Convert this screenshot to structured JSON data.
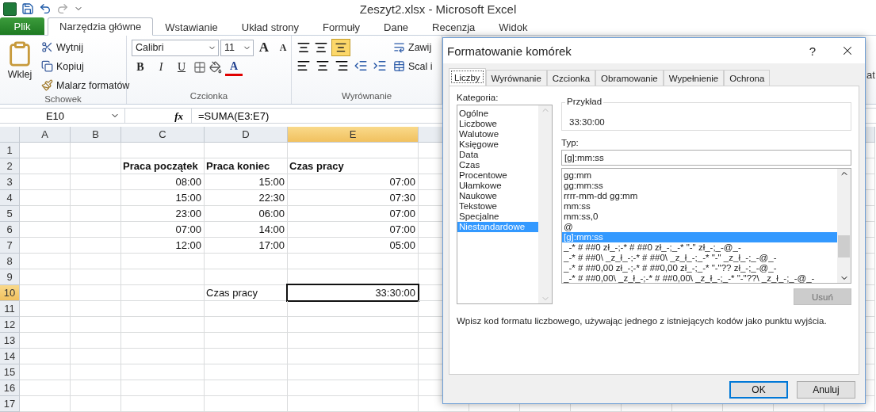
{
  "window": {
    "title": "Zeszyt2.xlsx - Microsoft Excel"
  },
  "ribbon": {
    "file_tab": "Plik",
    "tabs": [
      {
        "label": "Narzędzia główne",
        "selected": true
      },
      {
        "label": "Wstawianie",
        "selected": false
      },
      {
        "label": "Układ strony",
        "selected": false
      },
      {
        "label": "Formuły",
        "selected": false
      },
      {
        "label": "Dane",
        "selected": false
      },
      {
        "label": "Recenzja",
        "selected": false
      },
      {
        "label": "Widok",
        "selected": false
      }
    ],
    "clipboard": {
      "paste": "Wklej",
      "cut": "Wytnij",
      "copy": "Kopiuj",
      "painter": "Malarz formatów",
      "group": "Schowek"
    },
    "font": {
      "name": "Calibri",
      "size": "11",
      "grow": "A",
      "shrink": "A",
      "bold": "B",
      "italic": "I",
      "underline": "U",
      "font_color_letter": "A",
      "group": "Czcionka"
    },
    "alignment": {
      "wrap": "Zawij",
      "merge": "Scal i",
      "group": "Wyrównanie",
      "bottom_align_on": true
    },
    "cut_label": "at"
  },
  "formula_bar": {
    "name_box": "E10",
    "fx": "fx",
    "formula": "=SUMA(E3:E7)"
  },
  "sheet": {
    "columns": [
      {
        "label": "A",
        "selected": false
      },
      {
        "label": "B",
        "selected": false
      },
      {
        "label": "C",
        "selected": false
      },
      {
        "label": "D",
        "selected": false
      },
      {
        "label": "E",
        "selected": true
      }
    ],
    "rows": [
      {
        "label": "1",
        "selected": false,
        "kind": "blank"
      },
      {
        "label": "2",
        "selected": false,
        "kind": "heading",
        "c": "Praca początek",
        "d": "Praca koniec",
        "e": "Czas pracy"
      },
      {
        "label": "3",
        "selected": false,
        "kind": "times",
        "c": "08:00",
        "d": "15:00",
        "e": "07:00"
      },
      {
        "label": "4",
        "selected": false,
        "kind": "times",
        "c": "15:00",
        "d": "22:30",
        "e": "07:30"
      },
      {
        "label": "5",
        "selected": false,
        "kind": "times",
        "c": "23:00",
        "d": "06:00",
        "e": "07:00"
      },
      {
        "label": "6",
        "selected": false,
        "kind": "times",
        "c": "07:00",
        "d": "14:00",
        "e": "07:00"
      },
      {
        "label": "7",
        "selected": false,
        "kind": "times",
        "c": "12:00",
        "d": "17:00",
        "e": "05:00"
      },
      {
        "label": "8",
        "selected": false,
        "kind": "blank"
      },
      {
        "label": "9",
        "selected": false,
        "kind": "blank"
      },
      {
        "label": "10",
        "selected": true,
        "kind": "total",
        "d": "Czas pracy",
        "e": "33:30:00"
      },
      {
        "label": "11",
        "selected": false,
        "kind": "blank"
      },
      {
        "label": "12",
        "selected": false,
        "kind": "blank"
      },
      {
        "label": "13",
        "selected": false,
        "kind": "blank"
      },
      {
        "label": "14",
        "selected": false,
        "kind": "blank"
      },
      {
        "label": "15",
        "selected": false,
        "kind": "blank"
      },
      {
        "label": "16",
        "selected": false,
        "kind": "blank"
      },
      {
        "label": "17",
        "selected": false,
        "kind": "blank"
      }
    ]
  },
  "dialog": {
    "title": "Formatowanie komórek",
    "help": "?",
    "tabs": [
      {
        "label": "Liczby",
        "selected": true
      },
      {
        "label": "Wyrównanie",
        "selected": false
      },
      {
        "label": "Czcionka",
        "selected": false
      },
      {
        "label": "Obramowanie",
        "selected": false
      },
      {
        "label": "Wypełnienie",
        "selected": false
      },
      {
        "label": "Ochrona",
        "selected": false
      }
    ],
    "category_label": "Kategoria:",
    "categories": [
      {
        "label": "Ogólne",
        "selected": false
      },
      {
        "label": "Liczbowe",
        "selected": false
      },
      {
        "label": "Walutowe",
        "selected": false
      },
      {
        "label": "Księgowe",
        "selected": false
      },
      {
        "label": "Data",
        "selected": false
      },
      {
        "label": "Czas",
        "selected": false
      },
      {
        "label": "Procentowe",
        "selected": false
      },
      {
        "label": "Ułamkowe",
        "selected": false
      },
      {
        "label": "Naukowe",
        "selected": false
      },
      {
        "label": "Tekstowe",
        "selected": false
      },
      {
        "label": "Specjalne",
        "selected": false
      },
      {
        "label": "Niestandardowe",
        "selected": true
      }
    ],
    "sample_label": "Przykład",
    "sample": "33:30:00",
    "type_label": "Typ:",
    "type_value": "[g]:mm:ss",
    "formats": [
      {
        "label": "gg:mm",
        "selected": false
      },
      {
        "label": "gg:mm:ss",
        "selected": false
      },
      {
        "label": "rrrr-mm-dd gg:mm",
        "selected": false
      },
      {
        "label": "mm:ss",
        "selected": false
      },
      {
        "label": "mm:ss,0",
        "selected": false
      },
      {
        "label": "@",
        "selected": false
      },
      {
        "label": "[g]:mm:ss",
        "selected": true
      },
      {
        "label": "_-* # ##0 zł_-;-* # ##0 zł_-;_-* \"-\" zł_-;_-@_-",
        "selected": false
      },
      {
        "label": "_-* # ##0\\ _z_ł_-;-* # ##0\\ _z_ł_-;_-* \"-\" _z_ł_-;_-@_-",
        "selected": false
      },
      {
        "label": "_-* # ##0,00 zł_-;-* # ##0,00 zł_-;_-* \"-\"?? zł_-;_-@_-",
        "selected": false
      },
      {
        "label": "_-* # ##0,00\\ _z_ł_-;-* # ##0,00\\ _z_ł_-;_-* \"-\"??\\ _z_ł_-;_-@_-",
        "selected": false
      }
    ],
    "delete_button": {
      "label": "Usuń",
      "disabled": true
    },
    "hint": "Wpisz kod formatu liczbowego, używając jednego z istniejących kodów jako punktu wyjścia.",
    "buttons": [
      {
        "label": "OK",
        "kind": "default"
      },
      {
        "label": "Anuluj",
        "kind": "normal"
      }
    ]
  }
}
